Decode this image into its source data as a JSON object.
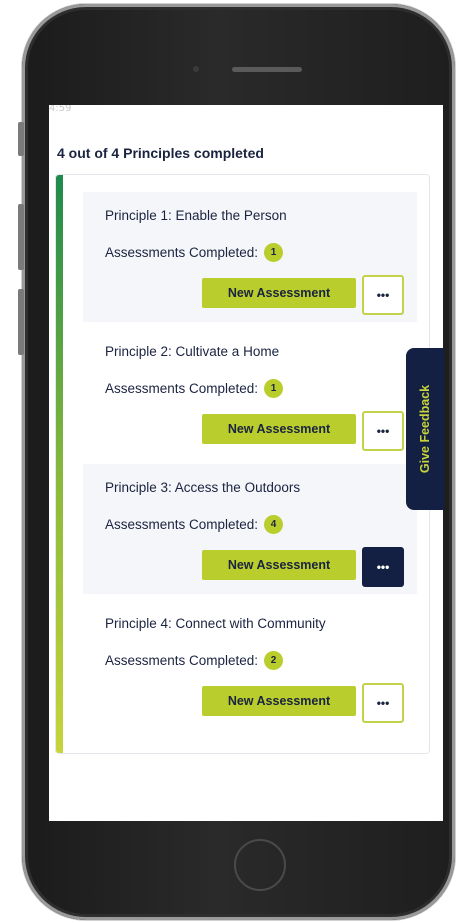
{
  "status_fragment": "4:59",
  "summary": "4 out of 4 Principles completed",
  "assessments_label": "Assessments Completed:",
  "new_assessment_label": "New Assessment",
  "more_label": "•••",
  "principles": [
    {
      "title": "Principle 1: Enable the Person",
      "count": "1"
    },
    {
      "title": "Principle 2: Cultivate a Home",
      "count": "1"
    },
    {
      "title": "Principle 3: Access the Outdoors",
      "count": "4"
    },
    {
      "title": "Principle 4: Connect with Community",
      "count": "2"
    }
  ],
  "feedback_label": "Give Feedback",
  "colors": {
    "navy": "#142043",
    "lime": "#b9ce2c",
    "accent_green": "#1f8a4c"
  }
}
